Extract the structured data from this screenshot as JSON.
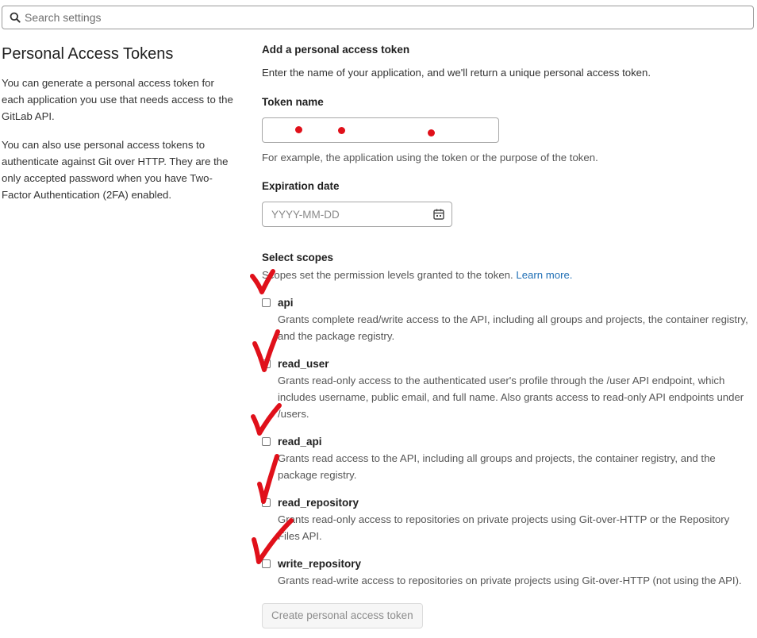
{
  "search": {
    "placeholder": "Search settings"
  },
  "intro": {
    "title": "Personal Access Tokens",
    "paragraph1": "You can generate a personal access token for each application you use that needs access to the GitLab API.",
    "paragraph2": "You can also use personal access tokens to authenticate against Git over HTTP. They are the only accepted password when you have Two-Factor Authentication (2FA) enabled."
  },
  "form": {
    "heading": "Add a personal access token",
    "description": "Enter the name of your application, and we'll return a unique personal access token.",
    "token_name": {
      "label": "Token name",
      "help": "For example, the application using the token or the purpose of the token."
    },
    "expiration": {
      "label": "Expiration date",
      "placeholder": "YYYY-MM-DD"
    },
    "scopes": {
      "label": "Select scopes",
      "description": "Scopes set the permission levels granted to the token.",
      "learn_more": "Learn more.",
      "items": [
        {
          "name": "api",
          "description": "Grants complete read/write access to the API, including all groups and projects, the container registry, and the package registry."
        },
        {
          "name": "read_user",
          "description": "Grants read-only access to the authenticated user's profile through the /user API endpoint, which includes username, public email, and full name. Also grants access to read-only API endpoints under /users."
        },
        {
          "name": "read_api",
          "description": "Grants read access to the API, including all groups and projects, the container registry, and the package registry."
        },
        {
          "name": "read_repository",
          "description": "Grants read-only access to repositories on private projects using Git-over-HTTP or the Repository Files API."
        },
        {
          "name": "write_repository",
          "description": "Grants read-write access to repositories on private projects using Git-over-HTTP (not using the API)."
        }
      ]
    },
    "submit_label": "Create personal access token"
  },
  "colors": {
    "annotation_red": "#e0101a",
    "link_blue": "#1f6fb5"
  },
  "icons": {
    "search": "search-icon",
    "calendar": "calendar-icon"
  }
}
